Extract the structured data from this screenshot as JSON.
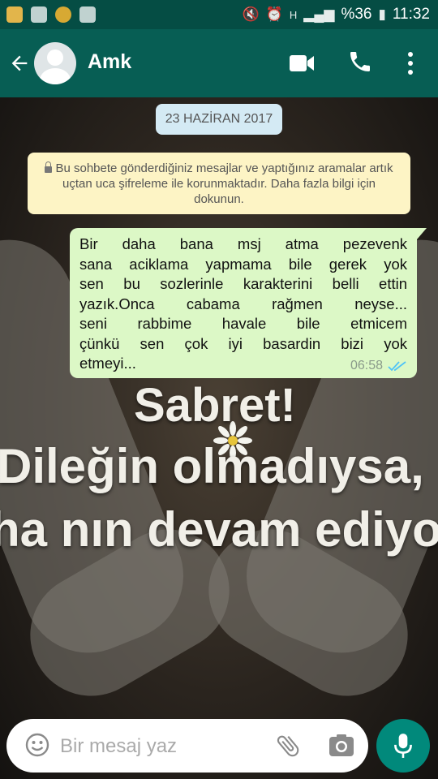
{
  "status_bar": {
    "battery": "%36",
    "time": "11:32",
    "network": "H"
  },
  "header": {
    "back_icon": "arrow-left-icon",
    "contact_name": "Amk",
    "video_icon": "video-camera-icon",
    "call_icon": "phone-icon",
    "menu_icon": "more-vert-icon"
  },
  "chat": {
    "date": "23 HAZİRAN 2017",
    "encryption_notice": "Bu sohbete gönderdiğiniz mesajlar ve yaptığınız aramalar artık uçtan uca şifreleme ile korunmaktadır. Daha fazla bilgi için dokunun.",
    "message": {
      "lines": [
        "Bir daha bana  msj atma pezevenk",
        "sana  aciklama yapmama bile gerek yok",
        "sen  bu sozlerinle karakterini belli ettin",
        "yazık.Onca cabama rağmen neyse...",
        "seni rabbime havale bile etmicem",
        "çünkü sen çok iyi basardin bizi yok",
        "etmeyi..."
      ],
      "time": "06:58",
      "status_icon": "double-check-read-icon"
    },
    "wallpaper_text": [
      "Sabret!",
      "Dileğin olmadıysa,",
      "ha nın devam ediyor"
    ]
  },
  "composer": {
    "placeholder": "Bir mesaj yaz",
    "emoji_icon": "emoji-icon",
    "attach_icon": "paperclip-icon",
    "camera_icon": "camera-icon",
    "mic_icon": "microphone-icon"
  },
  "colors": {
    "header": "#075e54",
    "status_bar": "#054d44",
    "outgoing_bubble": "#dcf8c6",
    "notice": "#fdf4c5",
    "date_chip": "#d4eaf4",
    "mic_button": "#01897b",
    "read_ticks": "#4fc3f7"
  }
}
